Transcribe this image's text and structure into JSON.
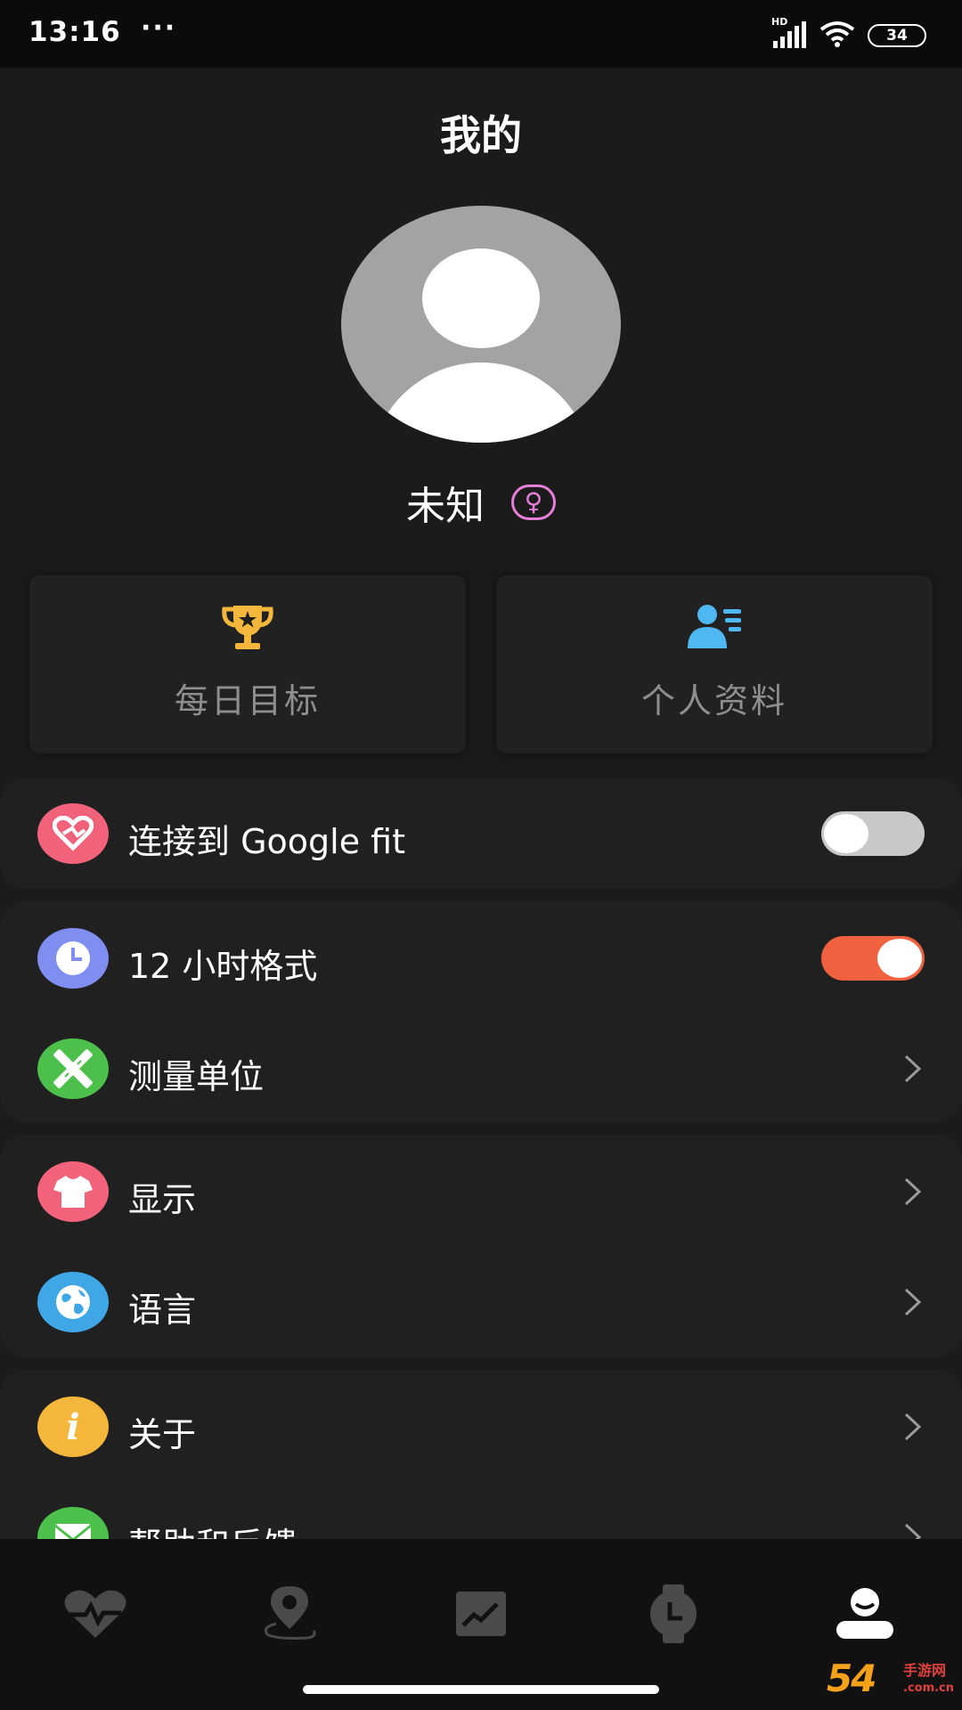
{
  "status_bar": {
    "time": "13:16",
    "dots": "···",
    "network_label": "HD",
    "battery": "34"
  },
  "page": {
    "title": "我的"
  },
  "user": {
    "name": "未知",
    "gender_symbol": "♀"
  },
  "quick_cards": [
    {
      "label": "每日目标",
      "icon": "trophy-icon",
      "icon_color": "#f5b73b"
    },
    {
      "label": "个人资料",
      "icon": "profile-card-icon",
      "icon_color": "#4fb7f2"
    }
  ],
  "menu": {
    "google_fit": {
      "label": "连接到 Google fit",
      "icon_color": "#f2627b",
      "enabled": false
    },
    "hour_format": {
      "label": "12 小时格式",
      "icon_color": "#7f8ef0",
      "enabled": true
    },
    "units": {
      "label": "测量单位",
      "icon_color": "#4cc04a"
    },
    "display": {
      "label": "显示",
      "icon_color": "#f2627b"
    },
    "language": {
      "label": "语言",
      "icon_color": "#3fa7e6"
    },
    "about": {
      "label": "关于",
      "icon_color": "#f5b73b"
    },
    "help": {
      "label": "帮助和反馈",
      "icon_color": "#4cc04a"
    }
  },
  "bottom_nav": {
    "items": [
      "heart-rate-icon",
      "location-icon",
      "trend-chart-icon",
      "watch-icon",
      "profile-icon"
    ],
    "active_index": 4
  },
  "colors": {
    "accent_toggle": "#f0623f",
    "gender": "#e77fd9"
  },
  "watermark": {
    "number": "54",
    "text": "手游网",
    "url": ".com.cn"
  }
}
